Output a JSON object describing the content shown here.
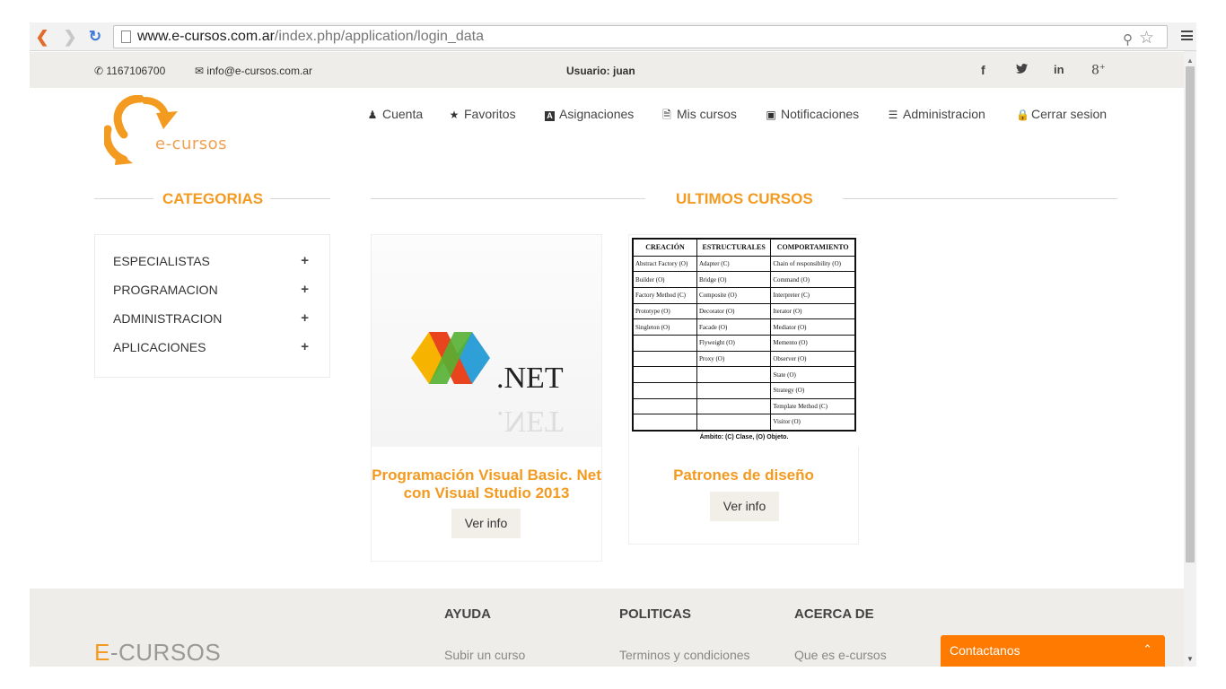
{
  "browser": {
    "url_host": "www.e-cursos.com.ar",
    "url_path": "/index.php/application/login_data",
    "icons": [
      "back-icon",
      "forward-icon",
      "reload-icon",
      "page-icon",
      "key-icon",
      "star-icon",
      "menu-icon"
    ]
  },
  "topbar": {
    "phone": "1167106700",
    "email": "info@e-cursos.com.ar",
    "user": "Usuario: juan",
    "social": [
      "facebook-icon",
      "twitter-icon",
      "linkedin-icon",
      "googleplus-icon"
    ]
  },
  "header": {
    "logo_text": "e-cursos",
    "nav": [
      {
        "label": "Cuenta",
        "icon": "user-icon"
      },
      {
        "label": "Favoritos",
        "icon": "star-icon"
      },
      {
        "label": "Asignaciones",
        "icon": "assignment-icon"
      },
      {
        "label": "Mis cursos",
        "icon": "file-icon"
      },
      {
        "label": "Notificaciones",
        "icon": "inbox-icon"
      },
      {
        "label": "Administracion",
        "icon": "list-icon"
      },
      {
        "label": "Cerrar sesion",
        "icon": "lock-icon"
      }
    ]
  },
  "categories": {
    "title": "CATEGORIAS",
    "items": [
      "ESPECIALISTAS",
      "PROGRAMACION",
      "ADMINISTRACION",
      "APLICACIONES"
    ]
  },
  "courses": {
    "title": "ULTIMOS CURSOS",
    "items": [
      {
        "title": "Programación Visual Basic. Net con Visual Studio 2013",
        "button": "Ver info",
        "image_text": ".NET"
      },
      {
        "title": "Patrones de diseño",
        "button": "Ver info"
      }
    ],
    "patterns_table": {
      "headers": [
        "CREACIÓN",
        "ESTRUCTURALES",
        "COMPORTAMIENTO"
      ],
      "rows": [
        [
          "Abstract Factory (O)",
          "Adapter (C)",
          "Chain of responsibility (O)"
        ],
        [
          "Builder (O)",
          "Bridge (O)",
          "Command (O)"
        ],
        [
          "Factory Method (C)",
          "Composite (O)",
          "Interpreter (C)"
        ],
        [
          "Prototype (O)",
          "Decorator (O)",
          "Iterator (O)"
        ],
        [
          "Singleton (O)",
          "Facade (O)",
          "Mediator (O)"
        ],
        [
          "",
          "Flyweight (O)",
          "Memento (O)"
        ],
        [
          "",
          "Proxy (O)",
          "Observer (O)"
        ],
        [
          "",
          "",
          "State (O)"
        ],
        [
          "",
          "",
          "Strategy (O)"
        ],
        [
          "",
          "",
          "Template Method (C)"
        ],
        [
          "",
          "",
          "Visitor (O)"
        ]
      ],
      "footnote": "Ámbito: (C) Clase, (O) Objeto."
    }
  },
  "footer": {
    "brand_e": "E",
    "brand_rest": "-CURSOS",
    "columns": [
      {
        "heading": "AYUDA",
        "link": "Subir un curso"
      },
      {
        "heading": "POLITICAS",
        "link": "Terminos y condiciones"
      },
      {
        "heading": "ACERCA DE",
        "link": "Que es e-cursos"
      }
    ]
  },
  "contact": {
    "label": "Contactanos"
  },
  "colors": {
    "accent": "#f39a20",
    "contact": "#ff7a00",
    "bar": "#eeede9"
  }
}
